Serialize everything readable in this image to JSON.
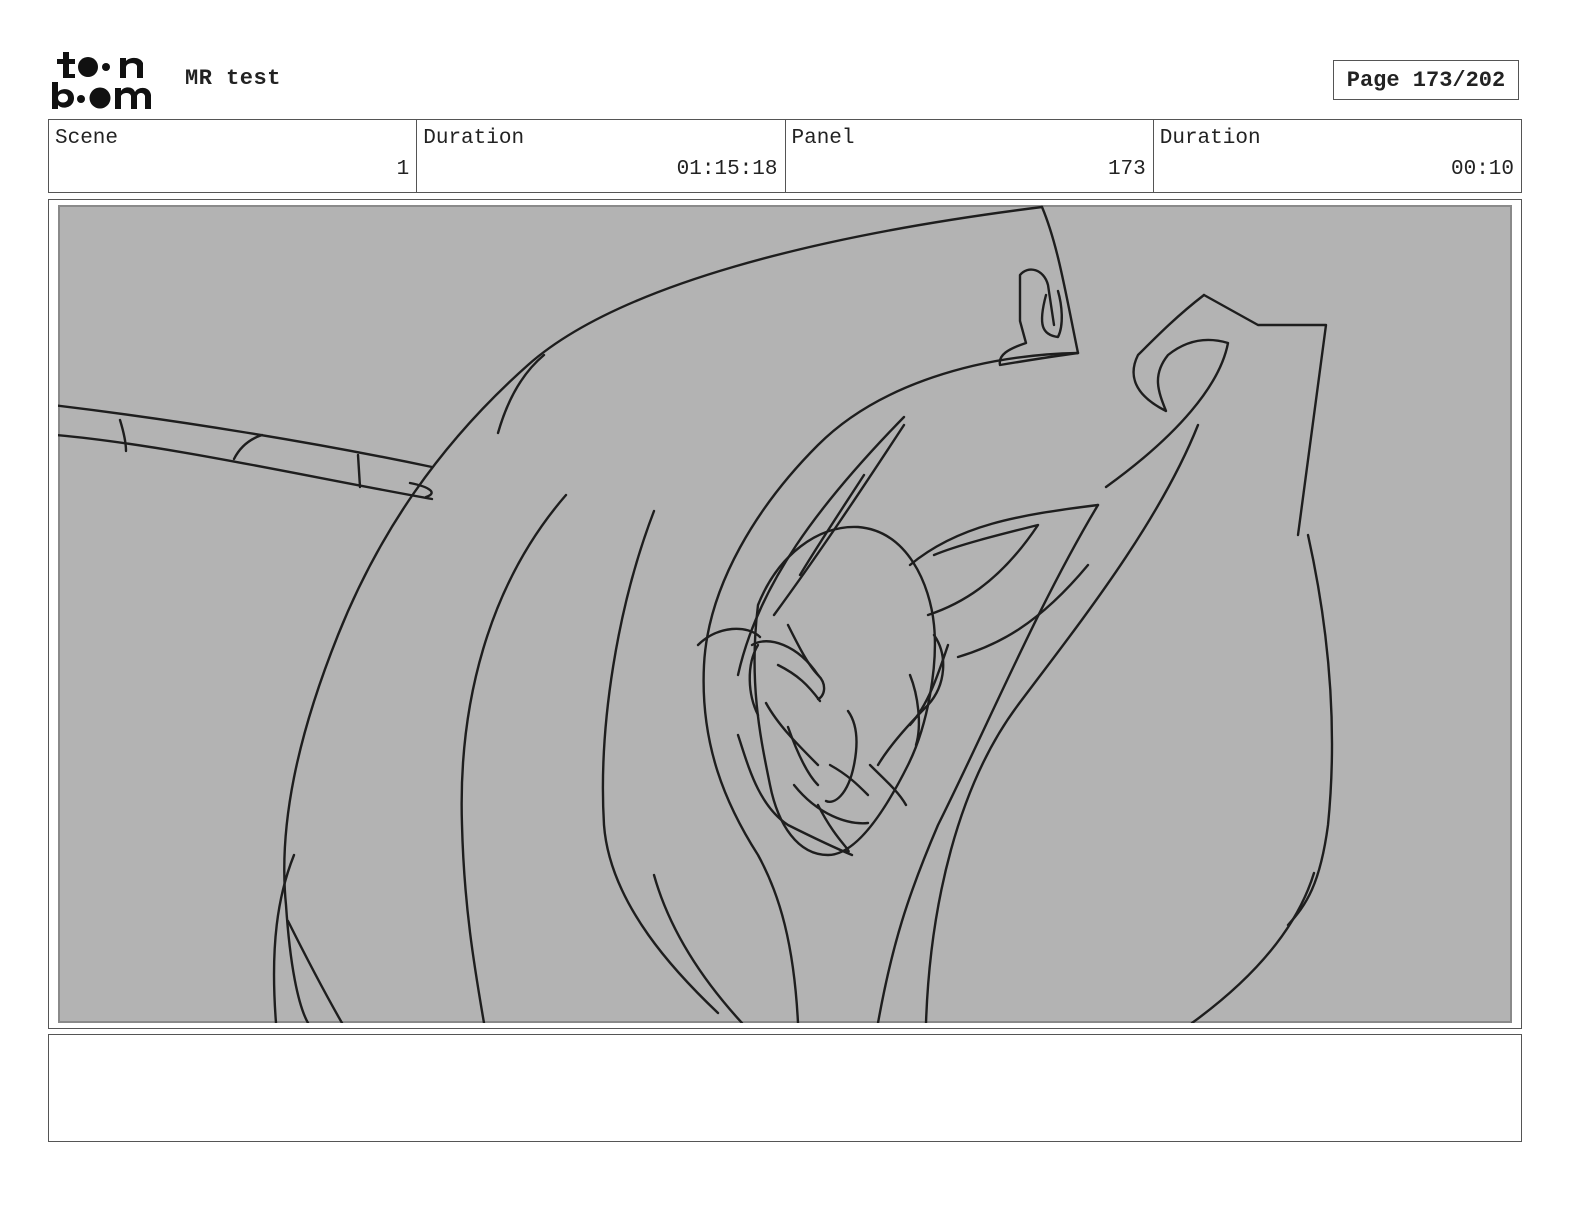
{
  "header": {
    "logo_text": "toon boom",
    "project_title": "MR test",
    "page_label": "Page 173/202"
  },
  "info": {
    "scene_label": "Scene",
    "scene_value": "1",
    "scene_duration_label": "Duration",
    "scene_duration_value": "01:15:18",
    "panel_label": "Panel",
    "panel_value": "173",
    "panel_duration_label": "Duration",
    "panel_duration_value": "00:10"
  },
  "panel": {
    "background_color": "#b3b3b3",
    "border_color": "#8a8a8a",
    "stroke_color": "#1e1e1e"
  },
  "notes": {
    "text": ""
  }
}
